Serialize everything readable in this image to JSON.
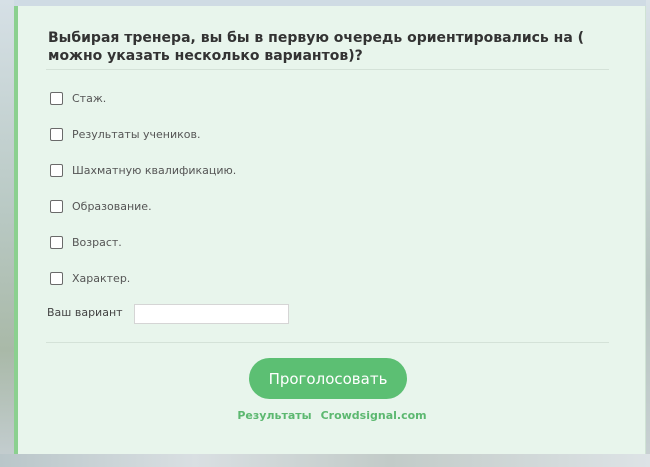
{
  "poll": {
    "question": "Выбирая тренера, вы бы в первую очередь ориентировались на ( можно указать несколько вариантов)?",
    "answers": [
      {
        "label": "Стаж.",
        "checked": false
      },
      {
        "label": "Результаты учеников.",
        "checked": false
      },
      {
        "label": "Шахматную квалификацию.",
        "checked": false
      },
      {
        "label": "Образование.",
        "checked": false
      },
      {
        "label": "Возраст.",
        "checked": false
      },
      {
        "label": "Характер.",
        "checked": false
      }
    ],
    "other_label": "Ваш вариант",
    "other_value": "",
    "vote_button": "Проголосовать",
    "results_link": "Результаты",
    "brand_link": "Crowdsignal.com"
  },
  "colors": {
    "accent": "#5cbf73",
    "panel_background": "#e8f5ec",
    "panel_border": "#8bd08f",
    "link": "#5cb870"
  }
}
